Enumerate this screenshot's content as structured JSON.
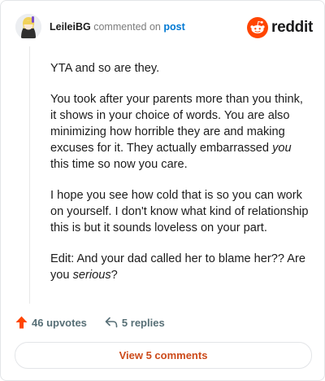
{
  "header": {
    "username": "LeileiBG",
    "action_text": "commented on",
    "target_link": "post",
    "logo_text": "reddit"
  },
  "comment": {
    "paragraphs": [
      {
        "text": "YTA and so are they."
      },
      {
        "text": "You took after your parents more than you think, it shows in your choice of words. You are also minimizing how horrible they are and making excuses for it. They actually embarrassed ",
        "em": "you",
        "tail": " this time so now you care."
      },
      {
        "text": "I hope you see how cold that is so you can work on yourself. I don't know what kind of relationship this is but it sounds loveless on your part."
      },
      {
        "text": "Edit: And your dad called her to blame her?? Are you ",
        "em": "serious",
        "tail": "?"
      }
    ]
  },
  "actions": {
    "upvotes_label": "46 upvotes",
    "replies_label": "5 replies"
  },
  "footer": {
    "view_comments_label": "View 5 comments"
  },
  "colors": {
    "accent": "#FF4500",
    "link": "#0079D3",
    "button_text": "#CC4A1A"
  }
}
